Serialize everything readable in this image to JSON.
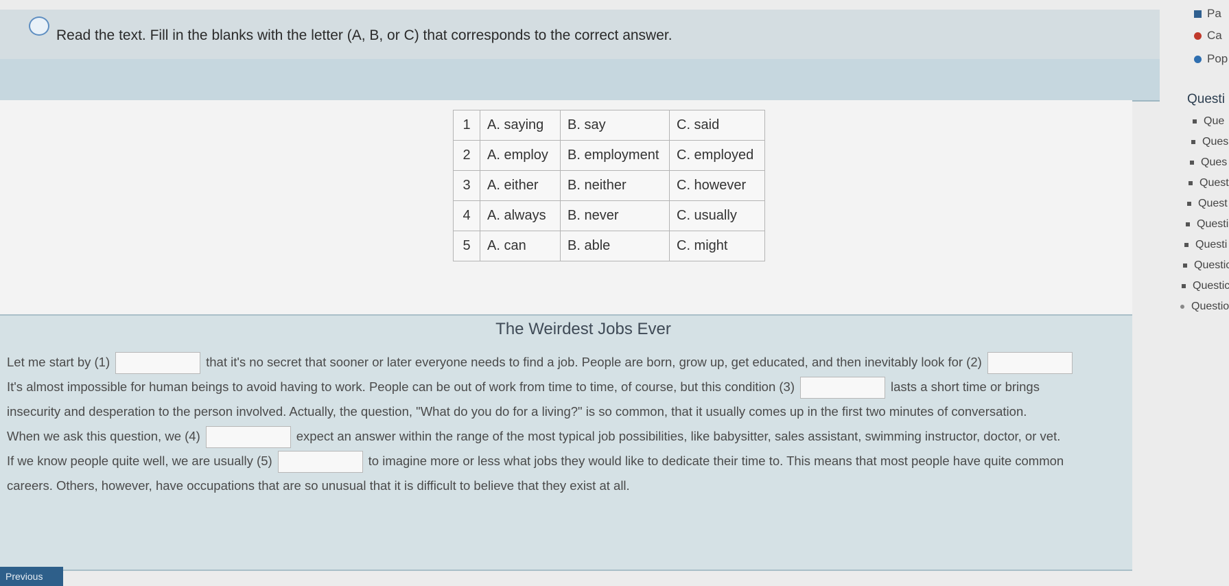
{
  "instruction": "Read the text. Fill in the blanks with the letter (A, B, or C) that corresponds to the correct answer.",
  "options_table": [
    {
      "num": "1",
      "a": "A. saying",
      "b": "B. say",
      "c": "C. said"
    },
    {
      "num": "2",
      "a": "A. employ",
      "b": "B. employment",
      "c": "C. employed"
    },
    {
      "num": "3",
      "a": "A. either",
      "b": "B. neither",
      "c": "C. however"
    },
    {
      "num": "4",
      "a": "A. always",
      "b": "B. never",
      "c": "C. usually"
    },
    {
      "num": "5",
      "a": "A. can",
      "b": "B. able",
      "c": "C. might"
    }
  ],
  "passage": {
    "title": "The Weirdest Jobs Ever",
    "line1_a": "Let me start by (1)",
    "line1_b": "that it's no secret that sooner or later everyone needs to find a job. People are born, grow up, get educated, and then inevitably look for (2)",
    "line2_a": "It's almost impossible for human beings to avoid having to work. People can be out of work from time to time, of course, but this condition (3)",
    "line2_b": "lasts a short time or brings",
    "line3": "insecurity and desperation to the person involved. Actually, the question, \"What do you do for a living?\" is so common, that it usually comes up in the first two minutes of conversation.",
    "line4_a": "When we ask this question, we (4)",
    "line4_b": "expect an answer within the range of the most typical job possibilities, like babysitter, sales assistant, swimming instructor, doctor, or vet.",
    "line5_a": "If we know people quite well, we are usually (5)",
    "line5_b": "to imagine more or less what jobs they would like to dedicate their time to. This means that most people have quite common",
    "line6": "careers. Others, however, have occupations that are so unusual that it is difficult to believe that they exist at all."
  },
  "previous_label": "Previous",
  "sidebar": {
    "legend": [
      {
        "label": "Pa",
        "color": "#2f5f8f"
      },
      {
        "label": "Ca",
        "color": "#c0392b"
      },
      {
        "label": "Pop",
        "color": "#2f6fb0"
      }
    ],
    "heading": "Questi",
    "questions": [
      "Que",
      "Ques",
      "Ques",
      "Quest",
      "Quest",
      "Questi",
      "Questi",
      "Questic",
      "Questic",
      "Questio"
    ]
  }
}
